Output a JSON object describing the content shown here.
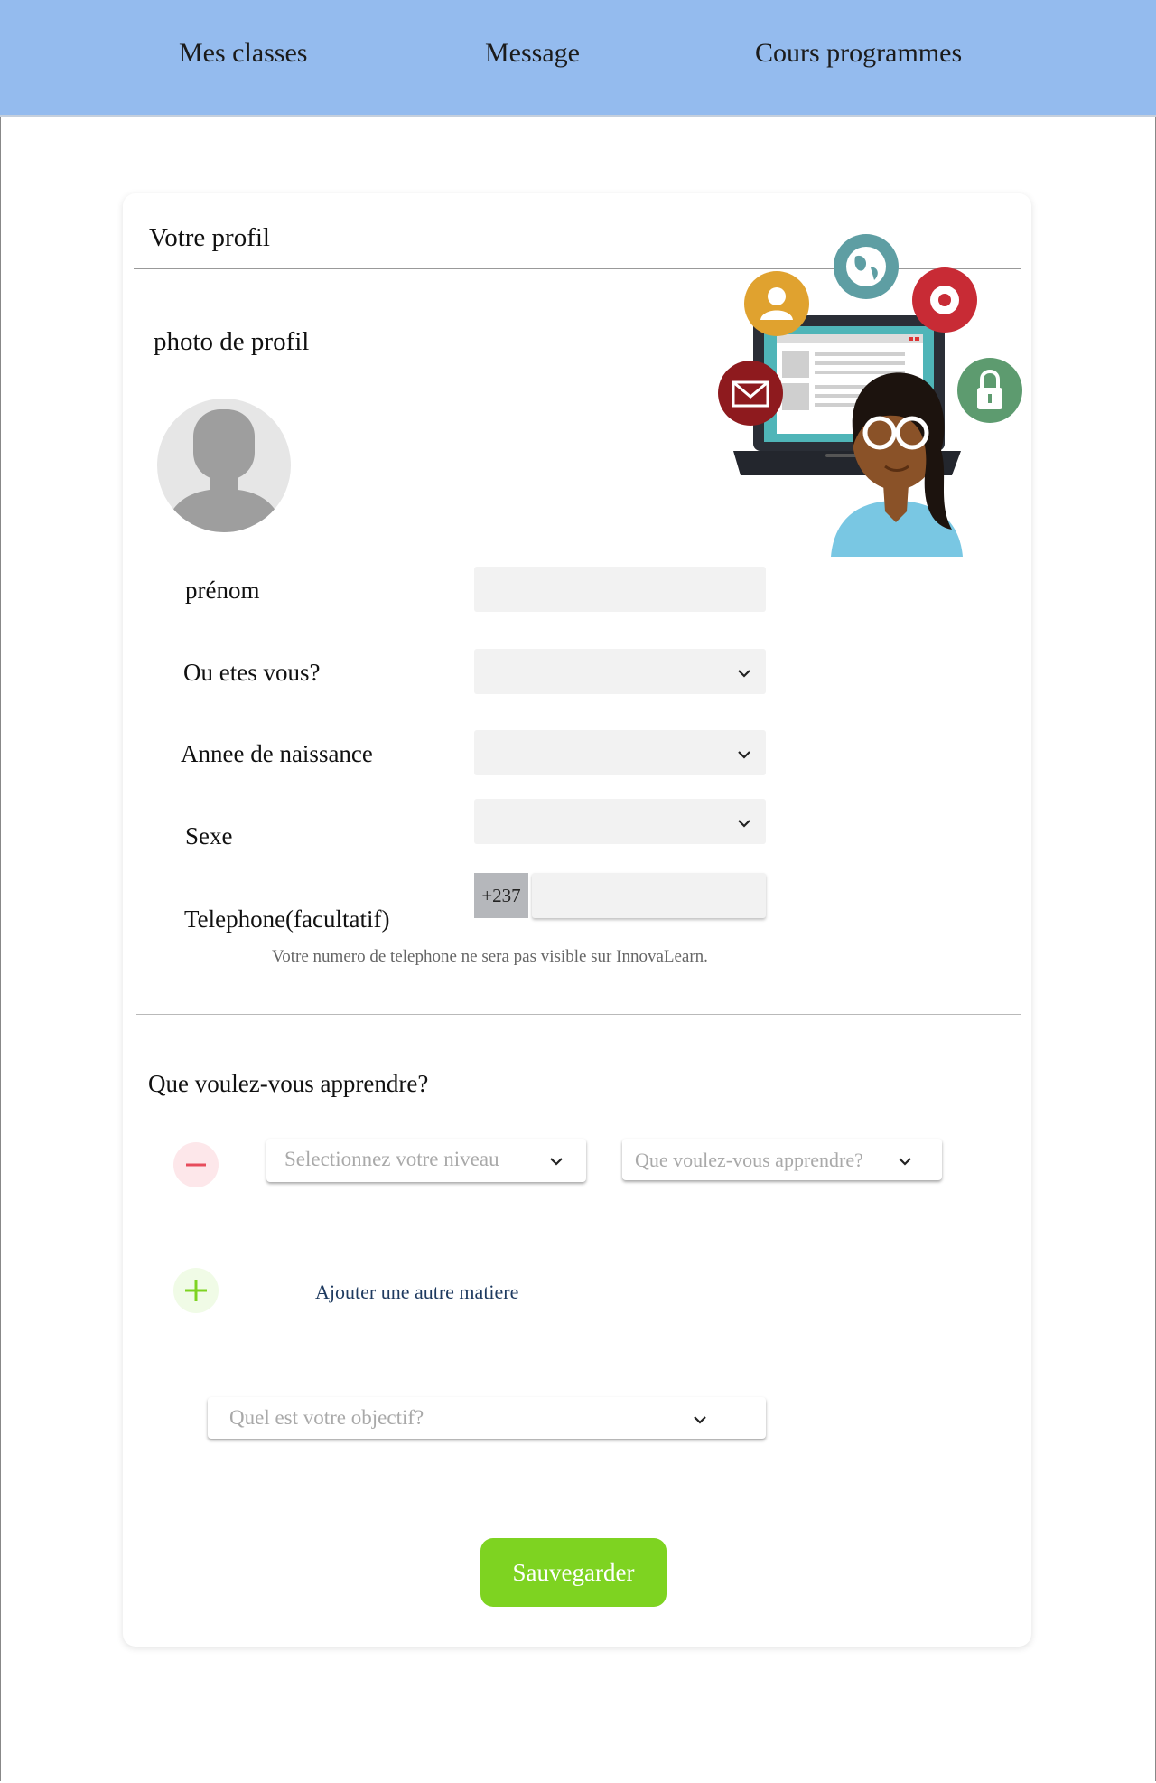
{
  "nav": {
    "items": [
      "Mes classes",
      "Message",
      "Cours programmes"
    ]
  },
  "profile": {
    "title": "Votre profil",
    "photo_label": "photo de profil",
    "fields": {
      "prenom_label": "prénom",
      "location_label": "Ou etes vous?",
      "birth_year_label": "Annee de naissance",
      "sex_label": "Sexe",
      "phone_label": "Telephone(facultatif)",
      "phone_prefix": "+237",
      "phone_note": "Votre numero de telephone ne sera pas visible sur InnovaLearn."
    }
  },
  "learning": {
    "title": "Que voulez-vous apprendre?",
    "level_placeholder": "Selectionnez votre niveau",
    "subject_placeholder": "Que voulez-vous apprendre?",
    "add_subject_label": "Ajouter une autre matiere",
    "objective_placeholder": "Quel est votre objectif?"
  },
  "actions": {
    "save_label": "Sauvegarder"
  },
  "colors": {
    "topbar": "#94bbee",
    "save": "#7ed321",
    "remove": "#e74c5c",
    "add": "#7ed321",
    "link": "#1e3a5f"
  },
  "icons": {
    "avatar": "avatar-placeholder-icon",
    "illustration": "woman-laptop-illustration",
    "remove": "minus-icon",
    "add": "plus-icon",
    "dropdown": "chevron-down-icon"
  }
}
